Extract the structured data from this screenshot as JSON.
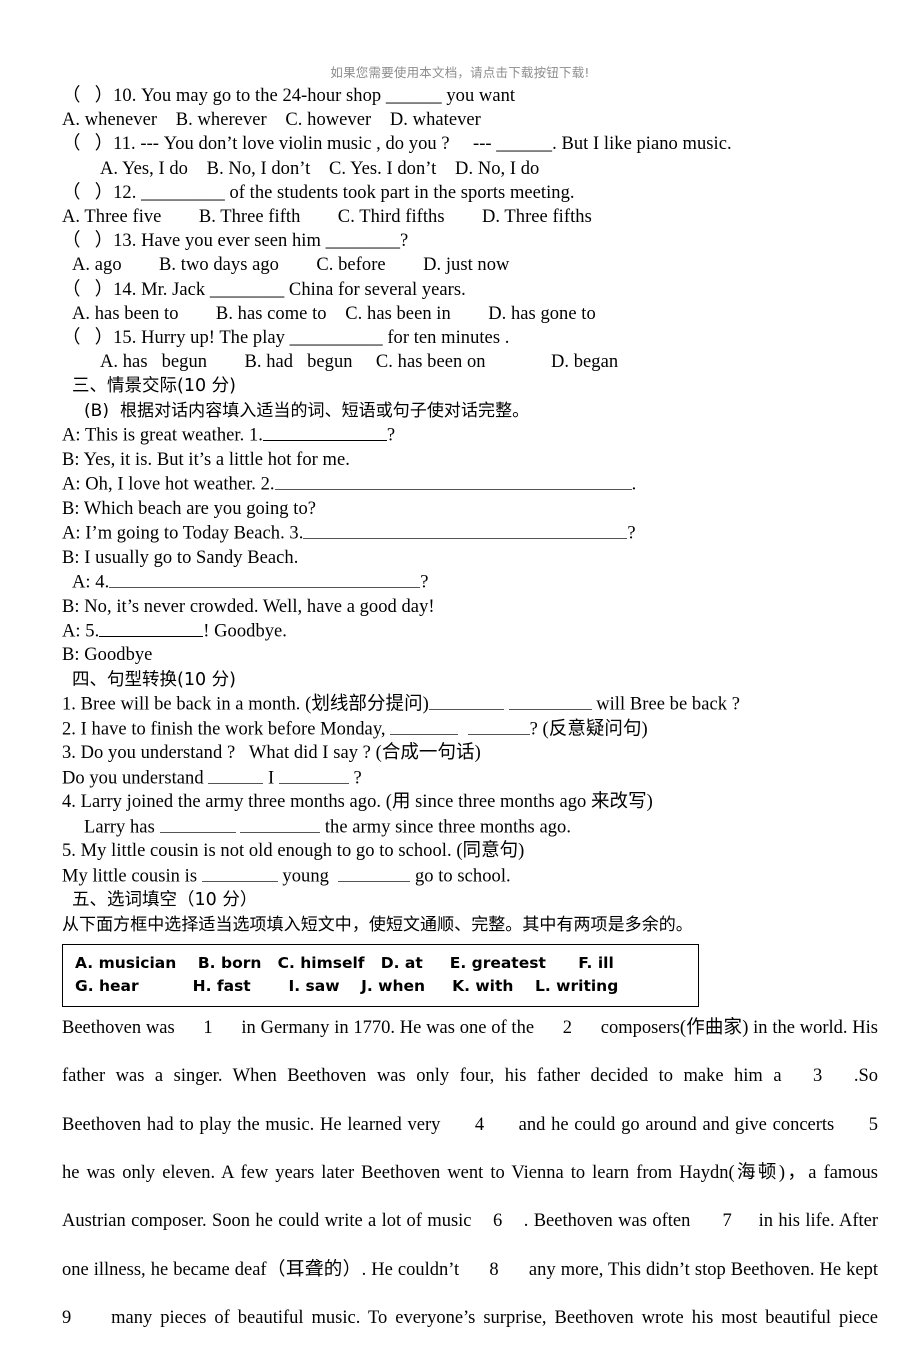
{
  "watermark": "如果您需要使用本文档，请点击下载按钮下载!",
  "multiple_choice": {
    "items": [
      {
        "stem": "（   ）10. You may go to the 24-hour shop ______ you want",
        "options": "A. whenever    B. wherever    C. however    D. whatever"
      },
      {
        "stem": "（   ）11. --- You don’t love violin music , do you ?     --- ______. But I like piano music.",
        "options": "A. Yes, I do    B. No, I don’t    C. Yes. I don’t    D. No, I do"
      },
      {
        "stem": "（   ）12. _________ of the students took part in the sports meeting.",
        "options": "A. Three five        B. Three fifth        C. Third fifths        D. Three fifths"
      },
      {
        "stem": "（   ）13. Have you ever seen him ________?",
        "options": "A. ago        B. two days ago        C. before        D. just now"
      },
      {
        "stem": "（   ）14. Mr. Jack ________ China for several years.",
        "options": "A. has been to        B. has come to    C. has been in        D. has gone to"
      },
      {
        "stem": "（   ）15. Hurry up! The play __________ for ten minutes .",
        "options": "A. has   begun        B. had   begun     C. has been on              D. began"
      }
    ]
  },
  "section_three": {
    "heading": "三、情景交际(10 分)",
    "instruction": "(B)  根据对话内容填入适当的词、短语或句子使对话完整。",
    "dialogue": [
      "A: This is great weather. 1.",
      "B: Yes, it is. But it’s a little hot for me.",
      "A: Oh, I love hot weather. 2.",
      "B: Which beach are you going to?",
      "A: I’m going to Today Beach. 3.",
      "B: I usually go to Sandy Beach.",
      "A: 4.",
      "B: No, it’s never crowded. Well, have a good day!",
      "A: 5.",
      "B: Goodbye"
    ],
    "dialogue_tail": {
      "line1_end": "?",
      "line3_end": ".",
      "line5_end": "?",
      "line7_end": "?",
      "line9_end": "! Goodbye."
    }
  },
  "section_four": {
    "heading": "四、句型转换(10 分)",
    "items": [
      {
        "part1": "1. Bree will be back in a month. (划线部分提问)",
        "part2": "",
        "part3": " will Bree be back ?"
      },
      {
        "part1": "2. I have to finish the work before Monday, ",
        "part2": "",
        "part3": "? (反意疑问句)"
      },
      {
        "part1": "3. Do you understand ?   What did I say ? (合成一句话)",
        "part2": "",
        "part3": ""
      },
      {
        "part1": "Do you understand ",
        "part2": " I ",
        "part3": " ?"
      },
      {
        "part1": "4. Larry joined the army three months ago. (用 since three months ago 来改写)",
        "part2": "",
        "part3": ""
      },
      {
        "part1": "Larry has ",
        "part2": "",
        "part3": " the army since three months ago."
      },
      {
        "part1": "5. My little cousin is not old enough to go to school. (同意句)",
        "part2": "",
        "part3": ""
      },
      {
        "part1": "My little cousin is ",
        "part2": " young ",
        "part3": " go to school."
      }
    ]
  },
  "section_five": {
    "heading": "五、选词填空（10 分）",
    "instruction": "从下面方框中选择适当选项填入短文中，使短文通顺、完整。其中有两项是多余的。",
    "word_bank": {
      "row1": "A. musician    B. born   C. himself   D. at     E. greatest      F. ill",
      "row2": "G. hear          H. fast       I. saw    J. when     K. with    L. writing"
    },
    "passage_lines": [
      "Beethoven was      1      in Germany in 1770. He was one of the      2      composers(作曲家) in the world. His",
      "father  was  a  singer.  When  Beethoven  was  only  four,  his  father  decided  to  make  him  a      3      .So",
      "Beethoven had to play the music. He learned very      4      and he could go around and give concerts      5",
      "he was only eleven. A few years later Beethoven went to Vienna to learn from Haydn(海顿)，a famous",
      "Austrian composer. Soon he could write a lot of music    6    . Beethoven was often      7     in his life. After",
      "one illness, he became deaf（耳聋的）. He couldn’t      8      any more, This didn’t stop Beethoven. He kept",
      "9     many pieces of beautiful music. To everyone’s surprise, Beethoven wrote his most beautiful piece"
    ]
  }
}
